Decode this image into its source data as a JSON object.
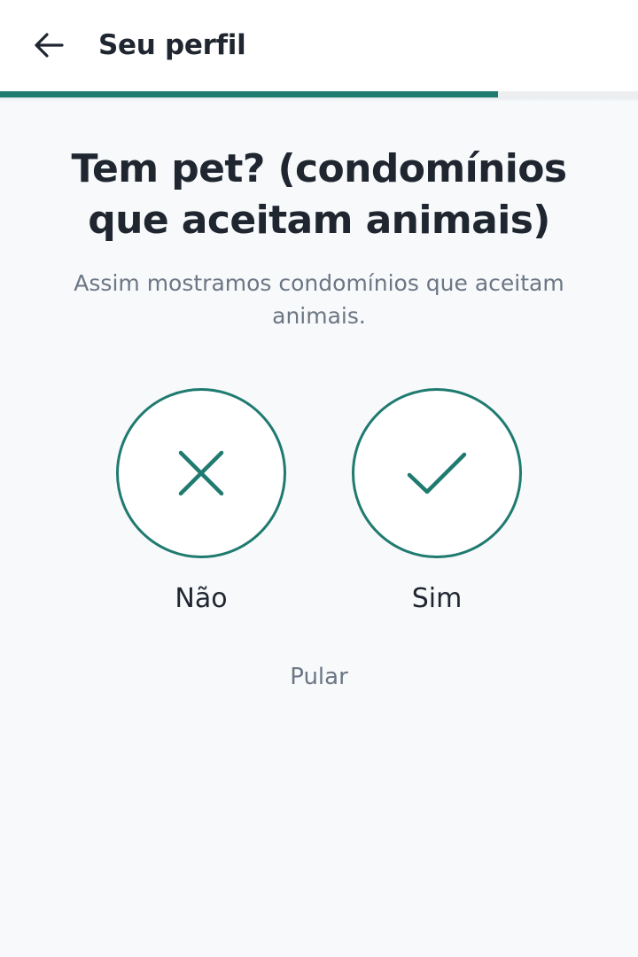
{
  "header": {
    "title": "Seu perfil",
    "back_icon": "arrow-left-icon"
  },
  "progress": {
    "value": 0.78
  },
  "question": {
    "title": "Tem pet? (condomínios que aceitam animais)",
    "subtitle": "Assim mostramos condomínios que aceitam animais."
  },
  "options": [
    {
      "label": "Não",
      "icon": "close-icon"
    },
    {
      "label": "Sim",
      "icon": "check-icon"
    }
  ],
  "skip_label": "Pular",
  "colors": {
    "accent": "#1f7a70",
    "text_primary": "#1f2630",
    "text_secondary": "#6c7684",
    "background": "#f7f9fb"
  }
}
